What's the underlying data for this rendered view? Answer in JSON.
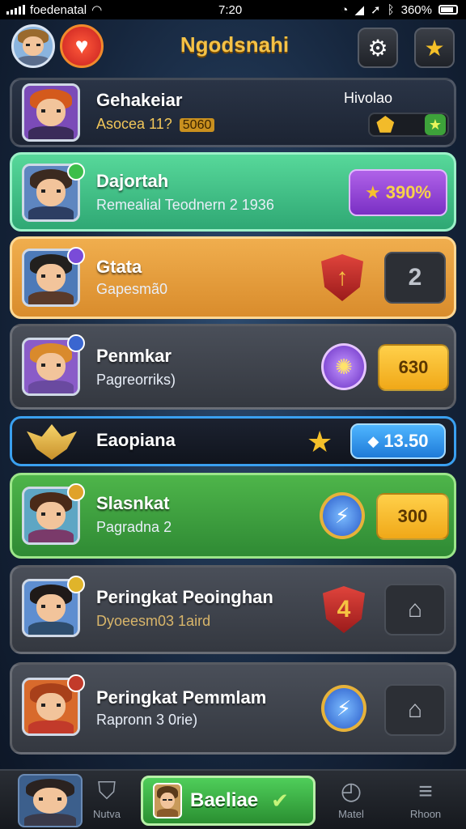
{
  "status_bar": {
    "carrier": "foedenatal",
    "time": "7:20",
    "battery": "360%"
  },
  "header": {
    "title": "Ngodsnahi"
  },
  "rows": [
    {
      "name": "Gehakeiar",
      "sub": "Asocea 11?",
      "sub_tag": "5060",
      "right_label": "Hivolao"
    },
    {
      "name": "Dajortah",
      "sub": "Remealial Teodnern 2 1936",
      "pill": "390%"
    },
    {
      "name": "Gtata",
      "sub": "Gapesmã0",
      "slot": "2"
    },
    {
      "name": "Penmkar",
      "sub": "Pagreorriks)",
      "pill": "630"
    },
    {
      "name": "Eaopiana",
      "pill": "13.50"
    },
    {
      "name": "Slasnkat",
      "sub": "Pagradna 2",
      "pill": "300"
    },
    {
      "name": "Peringkat Peoinghan",
      "sub": "Dyoeesm03 1aird",
      "emblem": "4"
    },
    {
      "name": "Peringkat Pemmlam",
      "sub": "Rapronn 3 0rie)"
    }
  ],
  "bottom_nav": {
    "items": [
      {
        "label": "Nutva"
      },
      {
        "label": "Matel"
      },
      {
        "label": "Rhoon"
      }
    ],
    "center_label": "Baeliae"
  }
}
